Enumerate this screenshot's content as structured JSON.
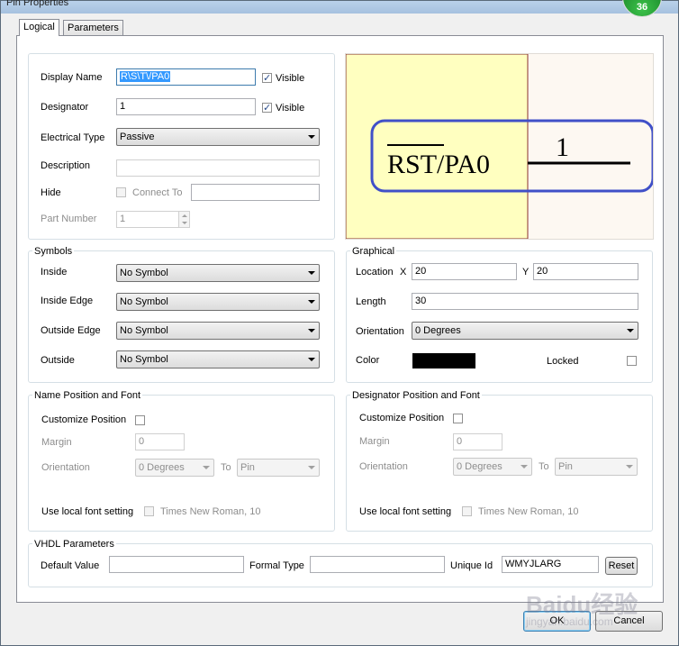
{
  "window": {
    "title": "Pin Properties",
    "badge": "36"
  },
  "tabs": [
    {
      "label": "Logical",
      "active": true
    },
    {
      "label": "Parameters",
      "active": false
    }
  ],
  "logical": {
    "display_name_label": "Display Name",
    "display_name_value": "R\\S\\T\\/PA0",
    "visible_label": "Visible",
    "designator_label": "Designator",
    "designator_value": "1",
    "electrical_type_label": "Electrical Type",
    "electrical_type_value": "Passive",
    "description_label": "Description",
    "description_value": "",
    "hide_label": "Hide",
    "connect_to_label": "Connect To",
    "connect_to_value": "",
    "part_number_label": "Part Number",
    "part_number_value": "1"
  },
  "preview": {
    "pin_name": "RST/PA0",
    "overline": "RST",
    "designator": "1",
    "colors": {
      "body": "#ffffc0",
      "highlight": "#4050c8",
      "background": "#fdf8f2"
    }
  },
  "symbols": {
    "title": "Symbols",
    "inside_label": "Inside",
    "inside_value": "No Symbol",
    "inside_edge_label": "Inside Edge",
    "inside_edge_value": "No Symbol",
    "outside_edge_label": "Outside Edge",
    "outside_edge_value": "No Symbol",
    "outside_label": "Outside",
    "outside_value": "No Symbol"
  },
  "graphical": {
    "title": "Graphical",
    "location_label": "Location",
    "x_label": "X",
    "x_value": "20",
    "y_label": "Y",
    "y_value": "20",
    "length_label": "Length",
    "length_value": "30",
    "orientation_label": "Orientation",
    "orientation_value": "0 Degrees",
    "color_label": "Color",
    "color_value": "#000000",
    "locked_label": "Locked"
  },
  "name_position": {
    "title": "Name Position and Font",
    "customize_label": "Customize Position",
    "margin_label": "Margin",
    "margin_value": "0",
    "orientation_label": "Orientation",
    "orientation_value": "0 Degrees",
    "to_label": "To",
    "to_value": "Pin",
    "font_label": "Use local font setting",
    "font_value": "Times New Roman, 10"
  },
  "designator_position": {
    "title": "Designator Position and Font",
    "customize_label": "Customize Position",
    "margin_label": "Margin",
    "margin_value": "0",
    "orientation_label": "Orientation",
    "orientation_value": "0 Degrees",
    "to_label": "To",
    "to_value": "Pin",
    "font_label": "Use local font setting",
    "font_value": "Times New Roman, 10"
  },
  "vhdl": {
    "title": "VHDL Parameters",
    "default_value_label": "Default Value",
    "default_value": "",
    "formal_type_label": "Formal Type",
    "formal_type_value": "",
    "unique_id_label": "Unique Id",
    "unique_id_value": "WMYJLARG",
    "reset_label": "Reset"
  },
  "footer": {
    "ok_label": "OK",
    "cancel_label": "Cancel"
  },
  "watermark": {
    "brand": "Baidu",
    "chinese": "经验",
    "url": "jingyan.baidu.com"
  }
}
